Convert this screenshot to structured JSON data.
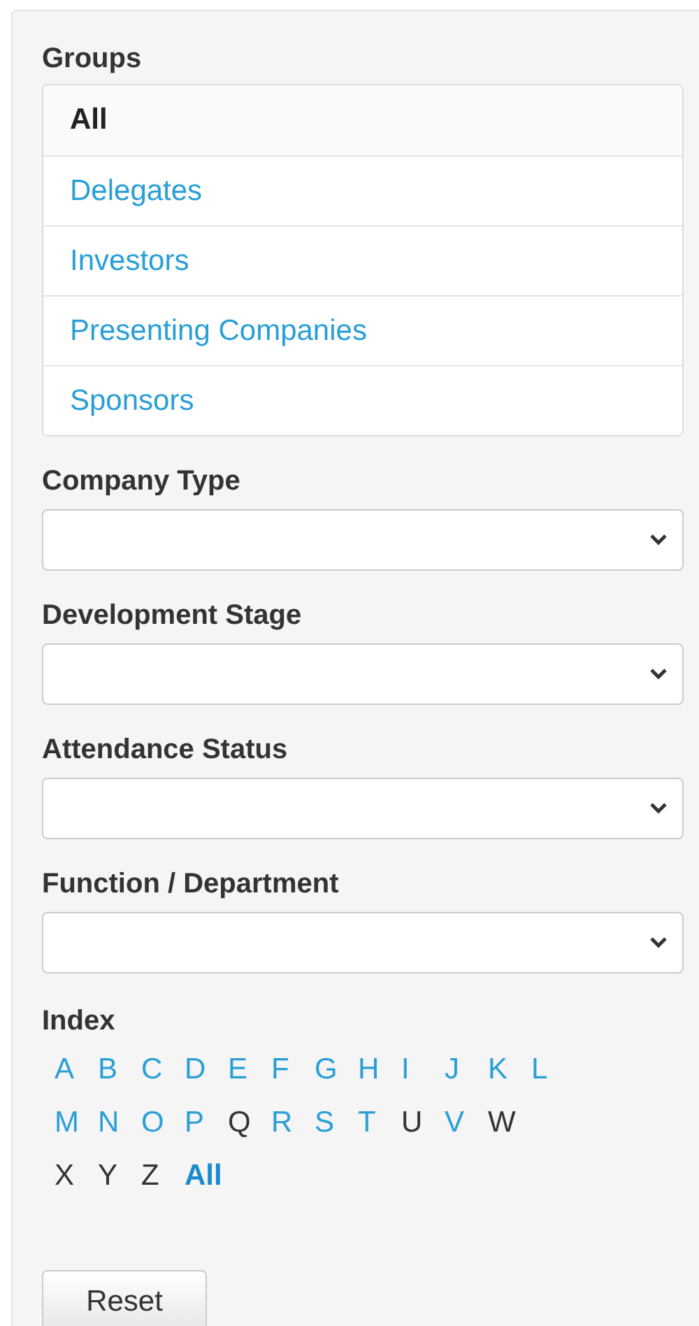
{
  "groups": {
    "title": "Groups",
    "items": [
      {
        "label": "All",
        "selected": true
      },
      {
        "label": "Delegates",
        "selected": false
      },
      {
        "label": "Investors",
        "selected": false
      },
      {
        "label": "Presenting Companies",
        "selected": false
      },
      {
        "label": "Sponsors",
        "selected": false
      }
    ]
  },
  "filters": [
    {
      "label": "Company Type"
    },
    {
      "label": "Development Stage"
    },
    {
      "label": "Attendance Status"
    },
    {
      "label": "Function / Department"
    }
  ],
  "index": {
    "title": "Index",
    "letters": [
      {
        "label": "A",
        "disabled": false,
        "selected": false
      },
      {
        "label": "B",
        "disabled": false,
        "selected": false
      },
      {
        "label": "C",
        "disabled": false,
        "selected": false
      },
      {
        "label": "D",
        "disabled": false,
        "selected": false
      },
      {
        "label": "E",
        "disabled": false,
        "selected": false
      },
      {
        "label": "F",
        "disabled": false,
        "selected": false
      },
      {
        "label": "G",
        "disabled": false,
        "selected": false
      },
      {
        "label": "H",
        "disabled": false,
        "selected": false
      },
      {
        "label": "I",
        "disabled": false,
        "selected": false
      },
      {
        "label": "J",
        "disabled": false,
        "selected": false
      },
      {
        "label": "K",
        "disabled": false,
        "selected": false
      },
      {
        "label": "L",
        "disabled": false,
        "selected": false
      },
      {
        "label": "M",
        "disabled": false,
        "selected": false
      },
      {
        "label": "N",
        "disabled": false,
        "selected": false
      },
      {
        "label": "O",
        "disabled": false,
        "selected": false
      },
      {
        "label": "P",
        "disabled": false,
        "selected": false
      },
      {
        "label": "Q",
        "disabled": true,
        "selected": false
      },
      {
        "label": "R",
        "disabled": false,
        "selected": false
      },
      {
        "label": "S",
        "disabled": false,
        "selected": false
      },
      {
        "label": "T",
        "disabled": false,
        "selected": false
      },
      {
        "label": "U",
        "disabled": true,
        "selected": false
      },
      {
        "label": "V",
        "disabled": false,
        "selected": false
      },
      {
        "label": "W",
        "disabled": true,
        "selected": false
      },
      {
        "label": "X",
        "disabled": true,
        "selected": false
      },
      {
        "label": "Y",
        "disabled": true,
        "selected": false
      },
      {
        "label": "Z",
        "disabled": true,
        "selected": false
      },
      {
        "label": "All",
        "disabled": false,
        "selected": true
      }
    ]
  },
  "reset_button": "Reset"
}
